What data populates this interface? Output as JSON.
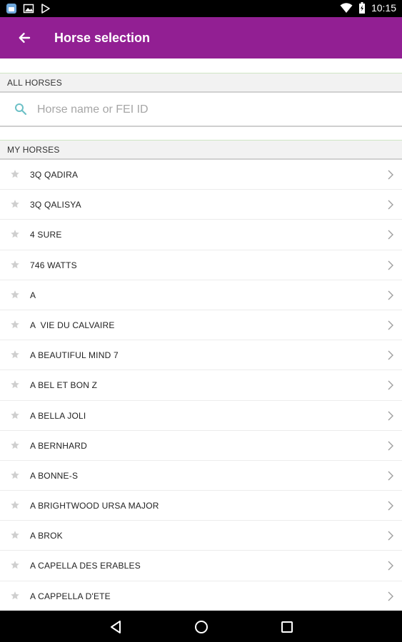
{
  "status_bar": {
    "time": "10:15",
    "icons": [
      "app-notification-icon",
      "image-icon",
      "play-store-icon",
      "wifi-icon",
      "battery-charging-icon"
    ]
  },
  "app_bar": {
    "title": "Horse selection",
    "back_icon": "arrow-left-icon",
    "color": "#921f93"
  },
  "all_horses": {
    "header": "ALL HORSES",
    "search": {
      "placeholder": "Horse name or FEI ID",
      "value": ""
    }
  },
  "my_horses": {
    "header": "MY HORSES",
    "items": [
      "3Q QADIRA",
      "3Q QALISYA",
      "4 SURE",
      "746 WATTS",
      "A",
      "A  VIE DU CALVAIRE",
      "A BEAUTIFUL MIND 7",
      "A BEL ET BON Z",
      "A BELLA JOLI",
      "A BERNHARD",
      "A BONNE-S",
      "A BRIGHTWOOD URSA MAJOR",
      "A BROK",
      "A CAPELLA DES ERABLES",
      "A CAPPELLA D'ETE"
    ]
  },
  "nav_bar": {
    "icons": [
      "back-triangle-icon",
      "home-circle-icon",
      "recents-square-icon"
    ]
  }
}
